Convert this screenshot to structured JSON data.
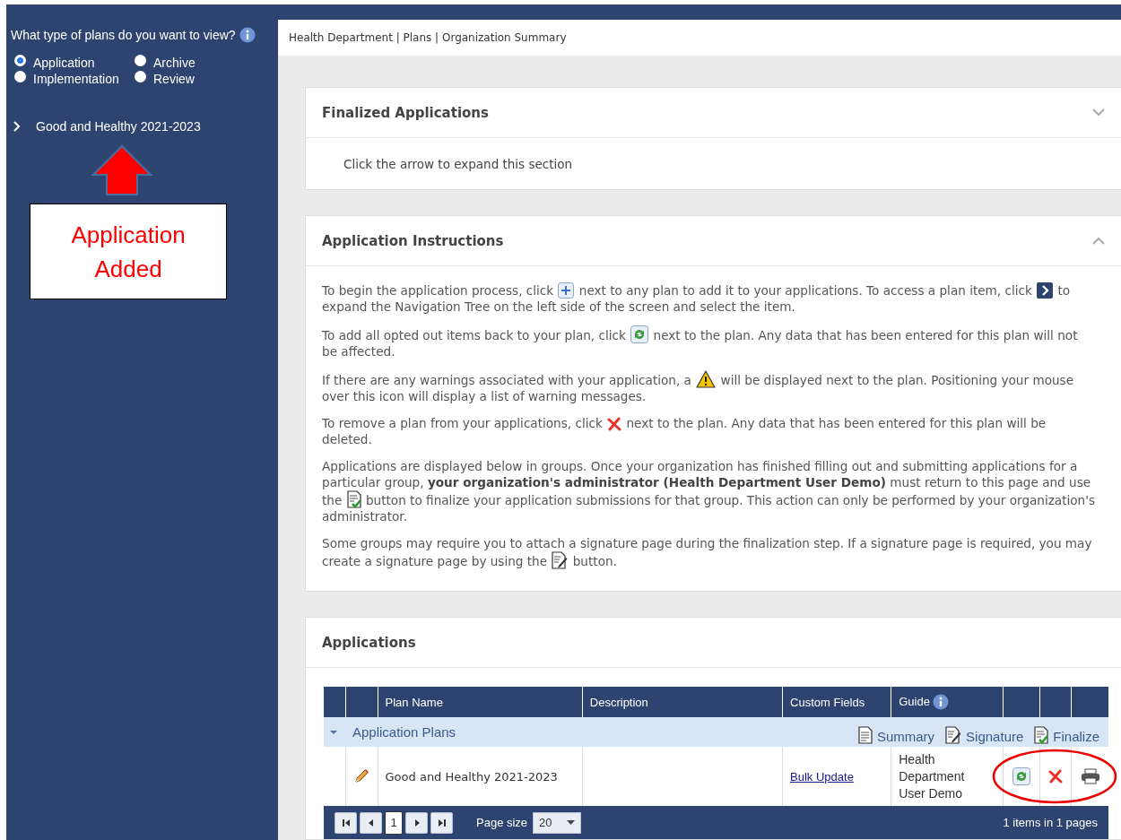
{
  "sidebar": {
    "question": "What type of plans do you want to view?",
    "plan_types": [
      {
        "label": "Application",
        "selected": true
      },
      {
        "label": "Archive",
        "selected": false
      },
      {
        "label": "Implementation",
        "selected": false
      },
      {
        "label": "Review",
        "selected": false
      }
    ],
    "tree": [
      {
        "label": "Good and Healthy 2021-2023",
        "expanded": false
      }
    ],
    "callout": "Application Added"
  },
  "breadcrumb": "Health Department | Plans | Organization Summary",
  "panels": [
    {
      "kind": "collapsible",
      "title": "Finalized Applications",
      "expanded": false,
      "hint": "Click the arrow to expand this section"
    },
    {
      "kind": "instructions",
      "title": "Application Instructions",
      "expanded": true,
      "paragraphs": [
        [
          {
            "kind": "text",
            "text": "To begin the application process, click "
          },
          {
            "kind": "add"
          },
          {
            "kind": "text",
            "text": " next to any plan to add it to your applications. To access a plan item, click "
          },
          {
            "kind": "expand"
          },
          {
            "kind": "text",
            "text": " to expand the Navigation Tree on the left side of the screen and select the item."
          }
        ],
        [
          {
            "kind": "text",
            "text": "To add all opted out items back to your plan, click "
          },
          {
            "kind": "restore"
          },
          {
            "kind": "text",
            "text": " next to the plan. Any data that has been entered for this plan will not be affected."
          }
        ],
        [
          {
            "kind": "text",
            "text": "If there are any warnings associated with your application, a "
          },
          {
            "kind": "warning"
          },
          {
            "kind": "text",
            "text": " will be displayed next to the plan. Positioning your mouse over this icon will display a list of warning messages."
          }
        ],
        [
          {
            "kind": "text",
            "text": "To remove a plan from your applications, click "
          },
          {
            "kind": "remove"
          },
          {
            "kind": "text",
            "text": " next to the plan. Any data that has been entered for this plan will be deleted."
          }
        ],
        [
          {
            "kind": "text",
            "text": "Applications are displayed below in groups. Once your organization has finished filling out and submitting applications for a particular group, **your organization's administrator (Health Department User Demo)** must return to this page and use the "
          },
          {
            "kind": "finalize"
          },
          {
            "kind": "text",
            "text": " button to finalize your application submissions for that group. This action can only be performed by your organization's administrator."
          }
        ],
        [
          {
            "kind": "text",
            "text": "Some groups may require you to attach a signature page during the finalization step. If a signature page is required, you may create a signature page by using the "
          },
          {
            "kind": "signature"
          },
          {
            "kind": "text",
            "text": " button."
          }
        ]
      ]
    },
    {
      "kind": "grid",
      "title": "Applications",
      "grid": {
        "columns": [
          {
            "label": "Plan Name",
            "info": false
          },
          {
            "label": "Description",
            "info": false
          },
          {
            "label": "Custom Fields",
            "info": false
          },
          {
            "label": "Guide",
            "info": true
          }
        ],
        "group": {
          "title": "Application Plans",
          "expanded": true,
          "actions": [
            {
              "label": "Summary",
              "kind": "summary"
            },
            {
              "label": "Signature",
              "kind": "signature"
            },
            {
              "label": "Finalize",
              "kind": "finalize"
            }
          ]
        },
        "rows": [
          {
            "plan_name": "Good and Healthy 2021-2023",
            "custom_fields": "Bulk Update",
            "guide": "Health Department User Demo",
            "actions_highlighted": true
          }
        ],
        "pager": {
          "current_page": "1",
          "page_size_label": "Page size",
          "page_size": "20",
          "summary": "1 items in 1 pages"
        }
      }
    }
  ]
}
